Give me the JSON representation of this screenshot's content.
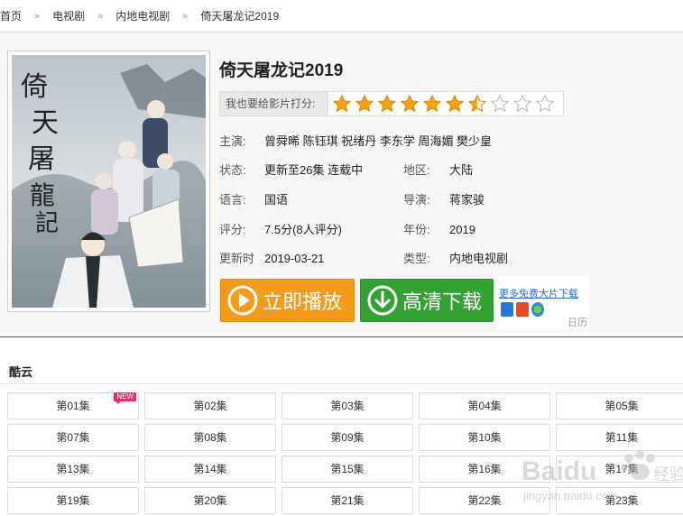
{
  "breadcrumb": [
    "首页",
    "电视剧",
    "内地电视剧",
    "倚天屠龙记2019"
  ],
  "breadcrumb_sep": "»",
  "movie": {
    "title": "倚天屠龙记2019",
    "rate_label": "我也要给影片打分:",
    "stars_filled": 6.5,
    "stars_total": 10,
    "cast_label": "主演:",
    "cast": "曾舜晞 陈钰琪 祝绪丹 李东学 周海媚 樊少皇",
    "status_label": "状态:",
    "status": "更新至26集 连载中",
    "region_label": "地区:",
    "region": "大陆",
    "language_label": "语言:",
    "language": "国语",
    "director_label": "导演:",
    "director": "蒋家骏",
    "score_label": "评分:",
    "score": "7.5分(8人评分)",
    "year_label": "年份:",
    "year": "2019",
    "updated_label": "更新时",
    "updated": "2019-03-21",
    "type_label": "类型:",
    "type": "内地电视剧"
  },
  "buttons": {
    "play": "立即播放",
    "download": "高清下载",
    "more_link": "更多免费大片下载",
    "calendar": "日历"
  },
  "colors": {
    "play": "#f59b1b",
    "download": "#33a232",
    "star": "#f2a30f",
    "badge": "#e2306c"
  },
  "source": {
    "title": "酷云"
  },
  "new_badge": "NEW",
  "episodes": [
    "第01集",
    "第02集",
    "第03集",
    "第04集",
    "第05集",
    "第07集",
    "第08集",
    "第09集",
    "第10集",
    "第11集",
    "第13集",
    "第14集",
    "第15集",
    "第16集",
    "第17集",
    "第19集",
    "第20集",
    "第21集",
    "第22集",
    "第23集"
  ],
  "watermark": {
    "brand": "Baidu",
    "sub": "经验",
    "url": "jingyan.baidu.com"
  }
}
